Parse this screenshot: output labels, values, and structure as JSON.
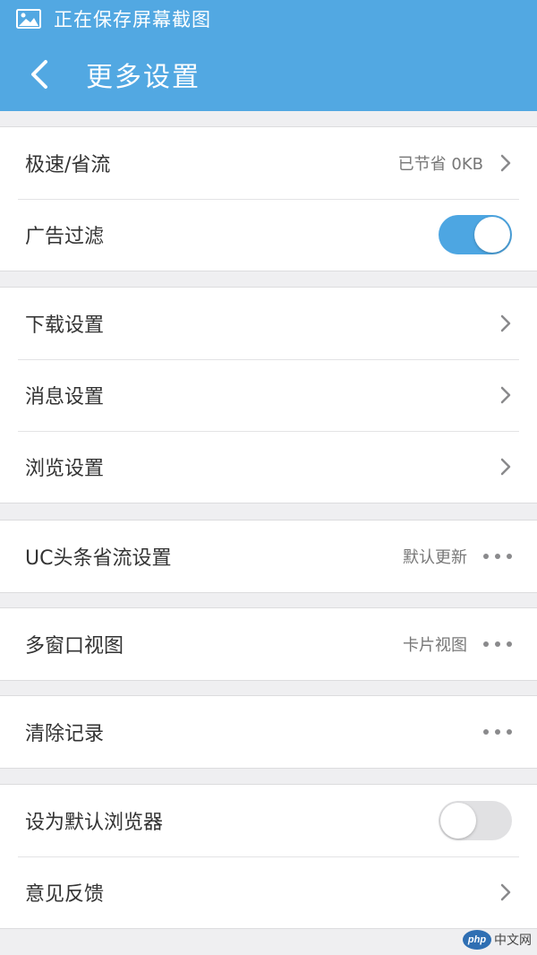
{
  "status_bar": {
    "text": "正在保存屏幕截图",
    "icon": "image-icon"
  },
  "header": {
    "title": "更多设置",
    "back_icon": "chevron-left-icon"
  },
  "groups": [
    {
      "items": [
        {
          "label": "极速/省流",
          "value": "已节省 0KB",
          "control": "chevron"
        },
        {
          "label": "广告过滤",
          "control": "toggle",
          "toggle_on": true
        }
      ]
    },
    {
      "items": [
        {
          "label": "下载设置",
          "control": "chevron"
        },
        {
          "label": "消息设置",
          "control": "chevron"
        },
        {
          "label": "浏览设置",
          "control": "chevron"
        }
      ]
    },
    {
      "items": [
        {
          "label": "UC头条省流设置",
          "value": "默认更新",
          "control": "more"
        }
      ]
    },
    {
      "items": [
        {
          "label": "多窗口视图",
          "value": "卡片视图",
          "control": "more"
        }
      ]
    },
    {
      "items": [
        {
          "label": "清除记录",
          "control": "more"
        }
      ]
    },
    {
      "items": [
        {
          "label": "设为默认浏览器",
          "control": "toggle",
          "toggle_on": false
        },
        {
          "label": "意见反馈",
          "control": "chevron"
        }
      ]
    }
  ],
  "watermark": {
    "badge": "php",
    "text": "中文网"
  },
  "colors": {
    "header_bg": "#52a8e2",
    "toggle_on": "#4da6e2",
    "toggle_off": "#e1e1e3",
    "page_bg": "#efeff1"
  }
}
